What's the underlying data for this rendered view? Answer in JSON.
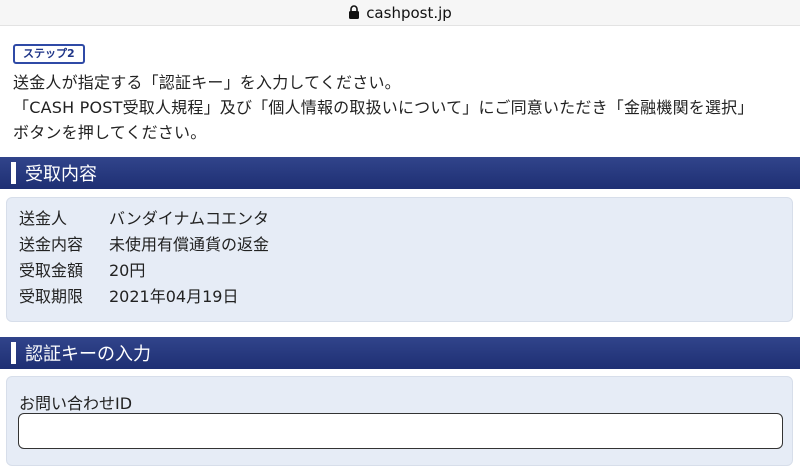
{
  "browser": {
    "url": "cashpost.jp"
  },
  "intro": {
    "step_badge": "ステップ2",
    "line1": "送金人が指定する「認証キー」を入力してください。",
    "line2": "「CASH POST受取人規程」及び「個人情報の取扱いについて」にご同意いただき「金融機関を選択」",
    "line3": "ボタンを押してください。"
  },
  "receipt_section": {
    "title": "受取内容",
    "rows": [
      {
        "label": "送金人",
        "value": "バンダイナムコエンタ"
      },
      {
        "label": "送金内容",
        "value": "未使用有償通貨の返金"
      },
      {
        "label": "受取金額",
        "value": "20円"
      },
      {
        "label": "受取期限",
        "value": "2021年04月19日"
      }
    ]
  },
  "auth_section": {
    "title": "認証キーの入力",
    "inquiry_label": "お問い合わせID",
    "inquiry_value": ""
  }
}
